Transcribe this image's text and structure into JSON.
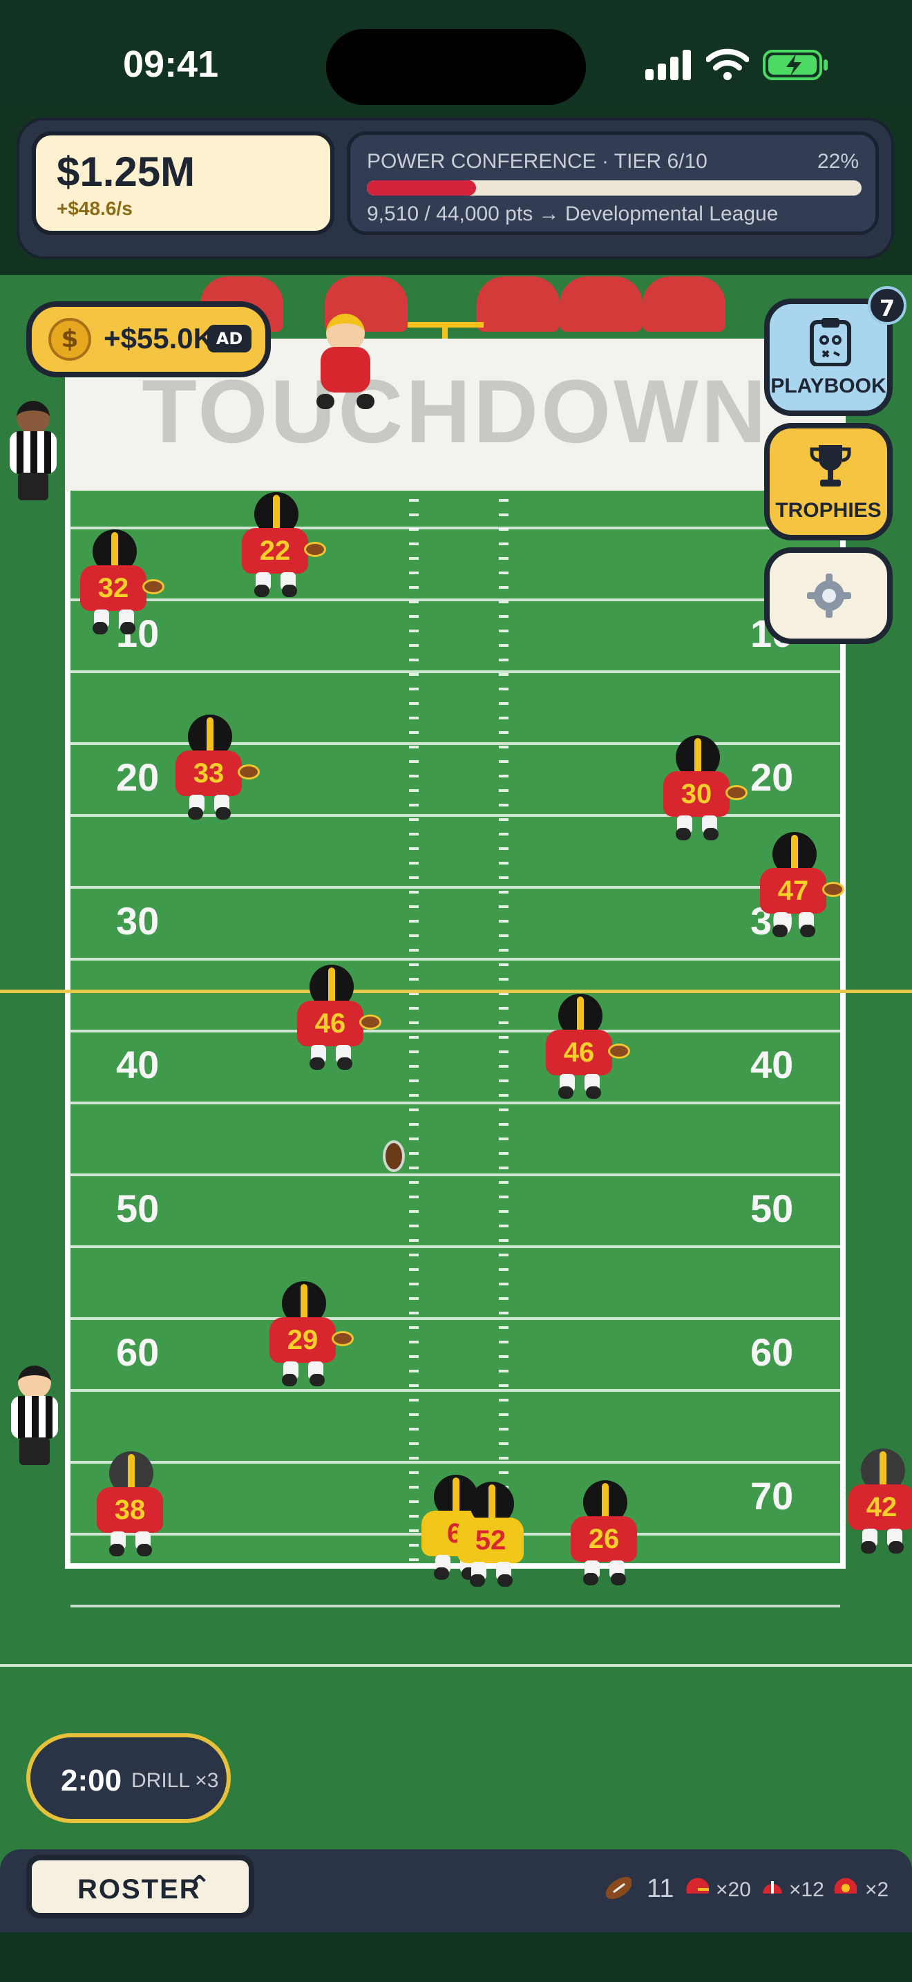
{
  "status_bar": {
    "time": "09:41"
  },
  "hud": {
    "money": "$1.25M",
    "income_rate": "+$48.6/s",
    "tier_title": "POWER CONFERENCE · TIER 6/10",
    "tier_percent": "22%",
    "tier_progress": 0.22,
    "tier_points": "9,510 / 44,000 pts → Developmental League"
  },
  "ad_offer": {
    "amount": "+$55.0K",
    "tag": "AD",
    "coin_symbol": "$"
  },
  "field": {
    "endzone_text": "TOUCHDOWN",
    "yard_numbers": [
      "10",
      "20",
      "30",
      "40",
      "50",
      "60",
      "70"
    ],
    "players": [
      {
        "number": "22",
        "style": "red"
      },
      {
        "number": "32",
        "style": "red"
      },
      {
        "number": "33",
        "style": "red"
      },
      {
        "number": "30",
        "style": "red"
      },
      {
        "number": "47",
        "style": "red"
      },
      {
        "number": "46",
        "style": "red"
      },
      {
        "number": "46",
        "style": "red"
      },
      {
        "number": "29",
        "style": "red"
      },
      {
        "number": "38",
        "style": "red"
      },
      {
        "number": "6",
        "style": "gold"
      },
      {
        "number": "52",
        "style": "gold"
      },
      {
        "number": "26",
        "style": "red"
      },
      {
        "number": "42",
        "style": "red"
      }
    ]
  },
  "side_buttons": {
    "playbook": {
      "label": "PLAYBOOK",
      "badge": "7"
    },
    "trophies": {
      "label": "TROPHIES"
    },
    "settings": {
      "icon": "gear-icon"
    }
  },
  "drill": {
    "time": "2:00",
    "label": "DRILL ×3"
  },
  "bottom_bar": {
    "roster_label": "ROSTER",
    "footballs": "11",
    "helmets_red": "×20",
    "helmets_small": "×12",
    "helmets_gold": "×2"
  },
  "colors": {
    "field_green": "#3f9a4c",
    "team_red": "#d7262e",
    "team_gold": "#f3c719",
    "hud_navy": "#2a3446",
    "progress_red": "#d3233b"
  }
}
